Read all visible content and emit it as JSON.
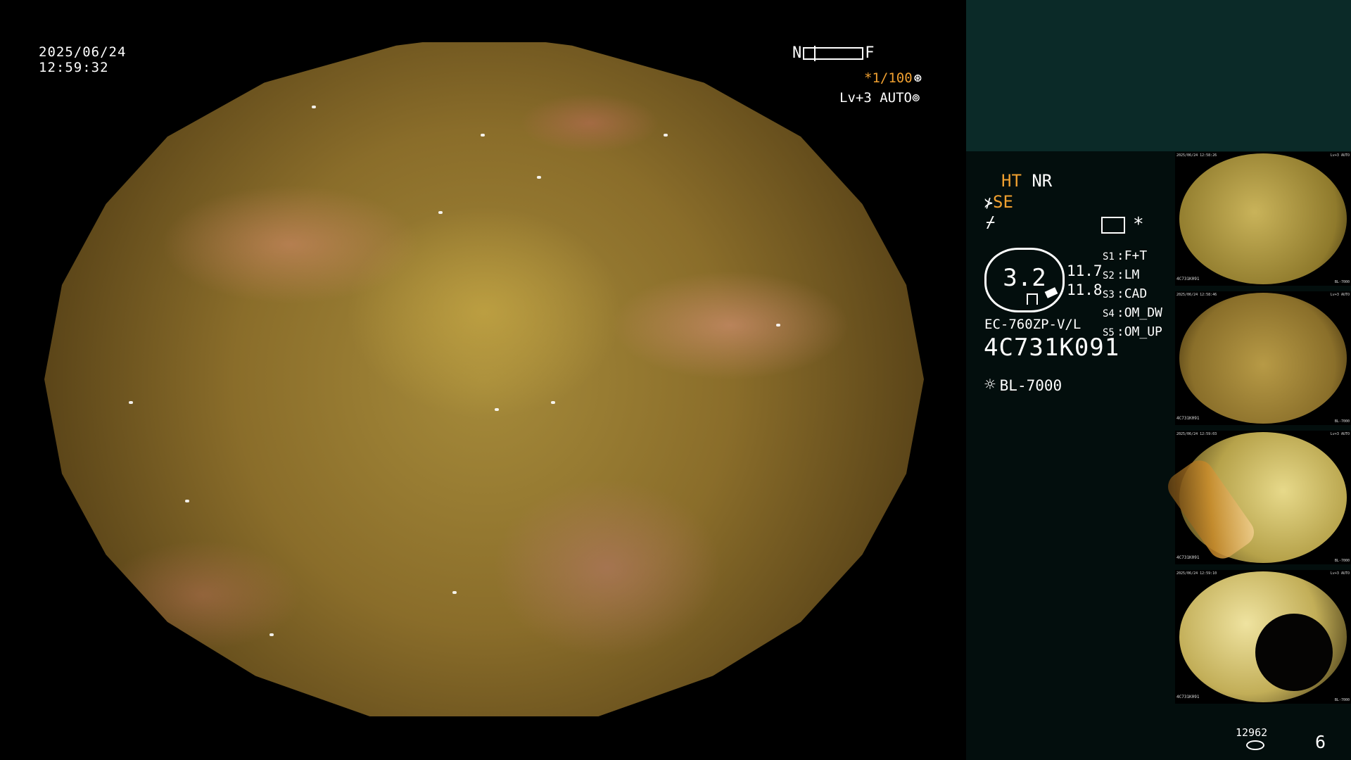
{
  "timestamp": {
    "date": "2025/06/24",
    "time": "12:59:32"
  },
  "focus": {
    "near": "N",
    "far": "F"
  },
  "shutter": {
    "value": "*1/100",
    "icon": "shutter-icon"
  },
  "level": {
    "label": "Lv+3 AUTO",
    "icon": "iris-icon"
  },
  "modes": {
    "ht": "HT",
    "nr": "NR",
    "se": "SE",
    "slash": "⌿"
  },
  "zoom": {
    "value": "3.2",
    "line1": "11.7",
    "line2": "11.8"
  },
  "scope": {
    "model": "EC-760ZP-V/L",
    "serial": "4C731K091"
  },
  "light_source": {
    "label": "BL-7000",
    "icon": "light-bulb-icon"
  },
  "slots": [
    {
      "key": "S1",
      "value": "F+T"
    },
    {
      "key": "S2",
      "value": "LM"
    },
    {
      "key": "S3",
      "value": "CAD"
    },
    {
      "key": "S4",
      "value": "OM_DW"
    },
    {
      "key": "S5",
      "value": "OM_UP"
    }
  ],
  "star": "*",
  "storage": {
    "count": "12962",
    "icon": "storage-disk-icon"
  },
  "page_number": "6",
  "thumbnails": [
    {
      "top_left": "2025/06/24 12:58:26",
      "top_right": "Lv+3 AUTO",
      "bottom_left": "4C731K091",
      "bottom_right": "BL-7000"
    },
    {
      "top_left": "2025/06/24 12:58:46",
      "top_right": "Lv+3 AUTO",
      "bottom_left": "4C731K091",
      "bottom_right": "BL-7000"
    },
    {
      "top_left": "2025/06/24 12:59:03",
      "top_right": "Lv+3 AUTO",
      "bottom_left": "4C731K091",
      "bottom_right": "BL-7000"
    },
    {
      "top_left": "2025/06/24 12:59:10",
      "top_right": "Lv+3 AUTO",
      "bottom_left": "4C731K091",
      "bottom_right": "BL-7000"
    }
  ]
}
